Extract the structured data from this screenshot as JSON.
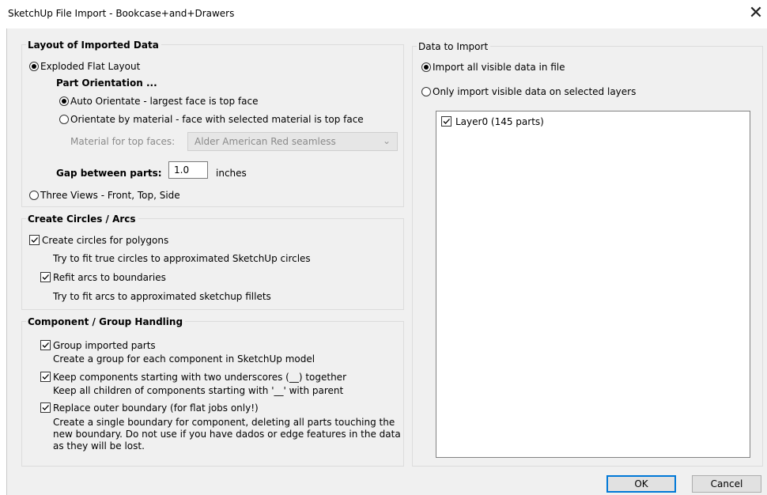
{
  "window": {
    "title": "SketchUp File Import - Bookcase+and+Drawers",
    "close_glyph": "✕"
  },
  "layout_group": {
    "legend": "Layout of Imported Data",
    "exploded_flat": "Exploded Flat Layout",
    "part_orientation": "Part Orientation ...",
    "auto_orientate": "Auto Orientate - largest face is top face",
    "orientate_by_material": "Orientate by material - face with selected material is top face",
    "material_label": "Material for top faces:",
    "material_value": "Alder American Red seamless",
    "gap_label": "Gap between parts:",
    "gap_value": "1.0",
    "gap_unit": "inches",
    "three_views": "Three Views - Front, Top, Side"
  },
  "circles_group": {
    "legend": "Create Circles / Arcs",
    "create_circles": "Create circles for polygons",
    "create_circles_desc": "Try to fit true circles to approximated SketchUp circles",
    "refit_arcs": "Refit arcs to boundaries",
    "refit_arcs_desc": "Try to fit arcs to approximated sketchup fillets"
  },
  "component_group": {
    "legend": "Component / Group Handling",
    "group_parts": "Group imported parts",
    "group_parts_desc": "Create a group for each component in SketchUp model",
    "keep_components": "Keep components starting with two underscores (__) together",
    "keep_components_desc": "Keep all children of components starting with '__' with parent",
    "replace_boundary": "Replace outer boundary (for flat jobs only!)",
    "replace_boundary_desc1": "Create a single boundary for component, deleting all parts touching the",
    "replace_boundary_desc2": "new boundary. Do not use if you have dados or edge features in the data",
    "replace_boundary_desc3": "as they will be lost."
  },
  "data_group": {
    "legend": "Data to Import",
    "import_all": "Import all visible data in file",
    "import_selected": "Only import visible data on selected layers",
    "layers": [
      {
        "label": "Layer0 (145 parts)",
        "checked": true
      }
    ]
  },
  "buttons": {
    "ok": "OK",
    "cancel": "Cancel"
  },
  "colors": {
    "dialog_bg": "#f0f0f0",
    "accent": "#0078d7"
  }
}
